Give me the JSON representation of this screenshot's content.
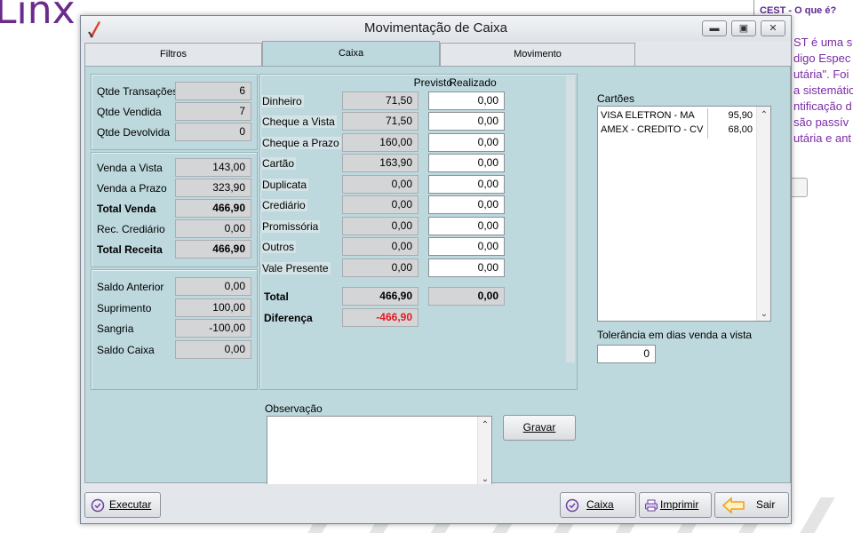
{
  "background": {
    "logo": "Linx",
    "side_title": "CEST - O que é?",
    "side_lines": [
      "ST é uma s",
      "digo Espec",
      "utária\". Foi",
      "a sistemátic",
      "ntificação d",
      "são passív",
      "utária e ant"
    ]
  },
  "window": {
    "title": "Movimentação de Caixa",
    "tabs": [
      "Filtros",
      "Caixa",
      "Movimento"
    ]
  },
  "summary": {
    "group1": [
      {
        "label": "Qtde Transações",
        "value": "6"
      },
      {
        "label": "Qtde Vendida",
        "value": "7"
      },
      {
        "label": "Qtde Devolvida",
        "value": "0"
      }
    ],
    "group2": [
      {
        "label": "Venda a Vista",
        "value": "143,00"
      },
      {
        "label": "Venda a Prazo",
        "value": "323,90"
      },
      {
        "label": "Total Venda",
        "value": "466,90"
      },
      {
        "label": "Rec. Crediário",
        "value": "0,00"
      },
      {
        "label": "Total Receita",
        "value": "466,90"
      }
    ],
    "group3": [
      {
        "label": "Saldo Anterior",
        "value": "0,00"
      },
      {
        "label": "Suprimento",
        "value": "100,00"
      },
      {
        "label": "Sangria",
        "value": "-100,00"
      },
      {
        "label": "Saldo Caixa",
        "value": "0,00"
      }
    ]
  },
  "grid": {
    "col_previsto": "Previsto",
    "col_realizado": "Realizado",
    "rows": [
      {
        "label": "Dinheiro",
        "previsto": "71,50",
        "realizado": "0,00"
      },
      {
        "label": "Cheque a Vista",
        "previsto": "71,50",
        "realizado": "0,00"
      },
      {
        "label": "Cheque a Prazo",
        "previsto": "160,00",
        "realizado": "0,00"
      },
      {
        "label": "Cartão",
        "previsto": "163,90",
        "realizado": "0,00"
      },
      {
        "label": "Duplicata",
        "previsto": "0,00",
        "realizado": "0,00"
      },
      {
        "label": "Crediário",
        "previsto": "0,00",
        "realizado": "0,00"
      },
      {
        "label": "Promissória",
        "previsto": "0,00",
        "realizado": "0,00"
      },
      {
        "label": "Outros",
        "previsto": "0,00",
        "realizado": "0,00"
      },
      {
        "label": "Vale Presente",
        "previsto": "0,00",
        "realizado": "0,00"
      }
    ],
    "total_label": "Total",
    "total_previsto": "466,90",
    "total_realizado": "0,00",
    "diferenca_label": "Diferença",
    "diferenca_value": "-466,90"
  },
  "cartoes": {
    "label": "Cartões",
    "items": [
      {
        "name": "VISA ELETRON - MA",
        "value": "95,90"
      },
      {
        "name": "AMEX - CREDITO - CV",
        "value": "68,00"
      }
    ],
    "tolerancia_label": "Tolerância em dias venda a vista",
    "tolerancia_value": "0"
  },
  "observacao": {
    "label": "Observação",
    "gravar": "Gravar"
  },
  "footer": {
    "executar": "Executar",
    "caixa": "Caixa",
    "imprimir": "Imprimir",
    "sair": "Sair"
  },
  "colors": {
    "panel_bg": "#bdd9de",
    "diferenca": "#e01b24"
  }
}
